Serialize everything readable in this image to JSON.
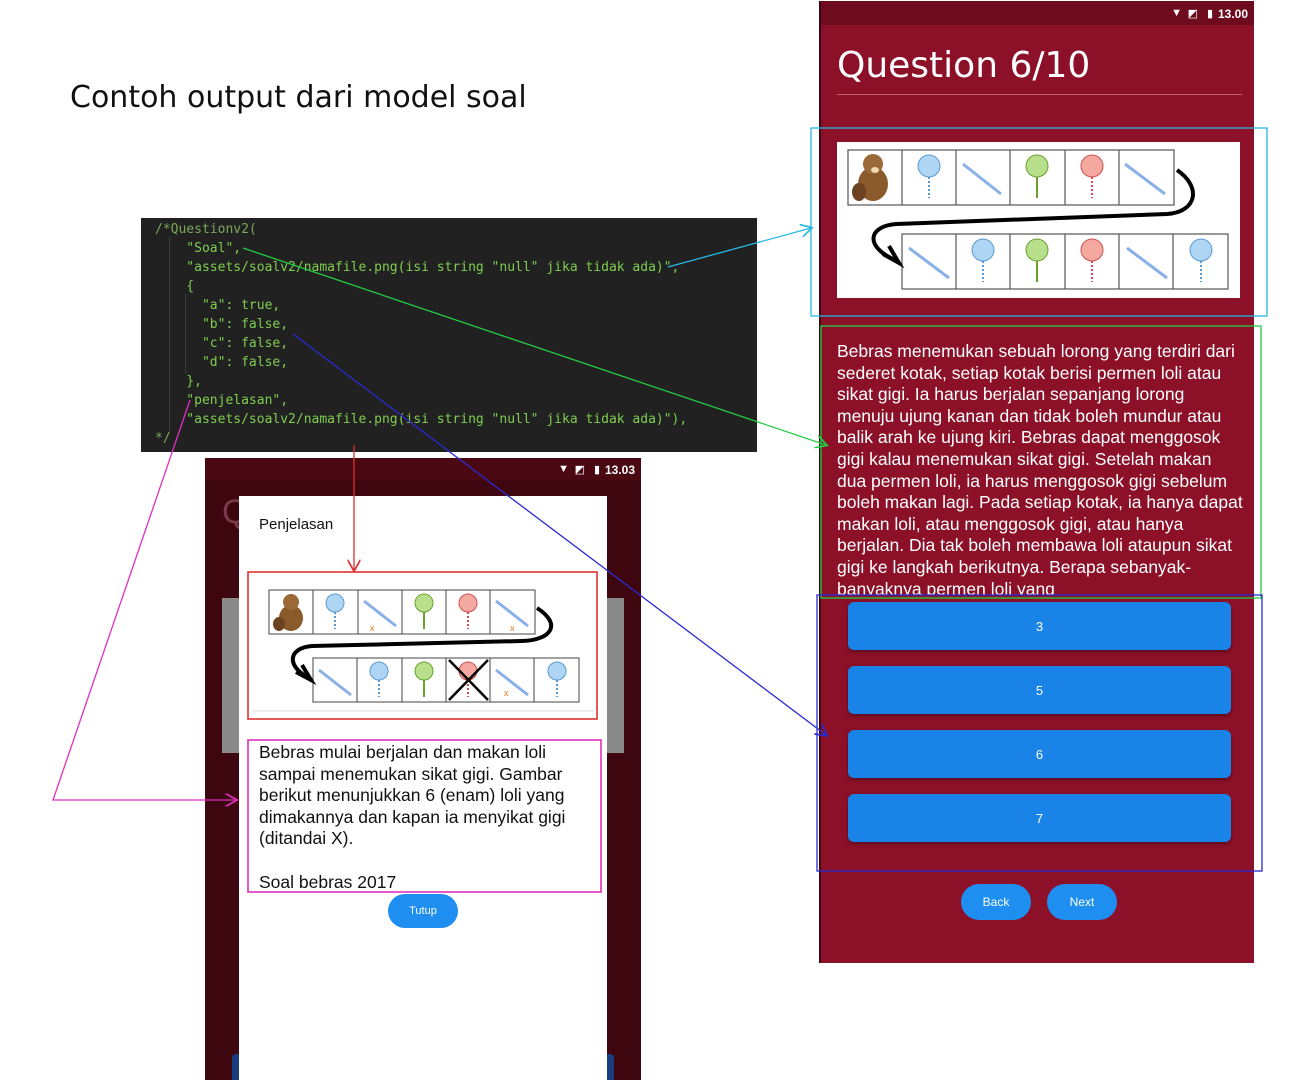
{
  "heading": "Contoh output dari model soal",
  "code": {
    "lines": [
      "/*Questionv2(",
      "    \"Soal\",",
      "    \"assets/soalv2/namafile.png(isi string \"null\" jika tidak ada)\",",
      "    {",
      "      \"a\": true,",
      "      \"b\": false,",
      "      \"c\": false,",
      "      \"d\": false,",
      "    },",
      "    \"penjelasan\",",
      "    \"assets/soalv2/namafile.png(isi string \"null\" jika tidak ada)\"),",
      "*/"
    ]
  },
  "question_screen": {
    "status_time": "13.00",
    "title": "Question 6/10",
    "question_text": "Bebras menemukan sebuah lorong yang terdiri dari sederet kotak, setiap kotak berisi permen loli atau sikat gigi. Ia harus berjalan sepanjang lorong menuju ujung kanan dan tidak boleh mundur atau balik arah ke ujung kiri. Bebras dapat menggosok gigi kalau menemukan sikat gigi. Setelah makan dua permen loli, ia harus menggosok gigi sebelum boleh makan lagi. Pada setiap kotak, ia hanya dapat makan loli, atau menggosok gigi, atau hanya berjalan. Dia tak boleh membawa loli ataupun sikat gigi ke langkah berikutnya. Berapa sebanyak-banyaknya permen loli yang",
    "options": [
      "3",
      "5",
      "6",
      "7"
    ],
    "back_label": "Back",
    "next_label": "Next"
  },
  "explanation_screen": {
    "status_time": "13.03",
    "dialog_title": "Penjelasan",
    "explanation_text": "Bebras mulai berjalan dan makan loli sampai menemukan sikat gigi. Gambar berikut menunjukkan 6 (enam) loli yang dimakannya dan kapan ia menyikat gigi (ditandai X).",
    "source_text": "Soal bebras 2017",
    "close_label": "Tutup"
  },
  "colors": {
    "phone_bg": "#8b1028",
    "button_blue": "#1a83e8",
    "arrow_cyan": "#28b8e0",
    "arrow_green": "#22cc44",
    "arrow_blue": "#2a2ad0",
    "arrow_magenta": "#e030c0",
    "arrow_red": "#e03030"
  }
}
